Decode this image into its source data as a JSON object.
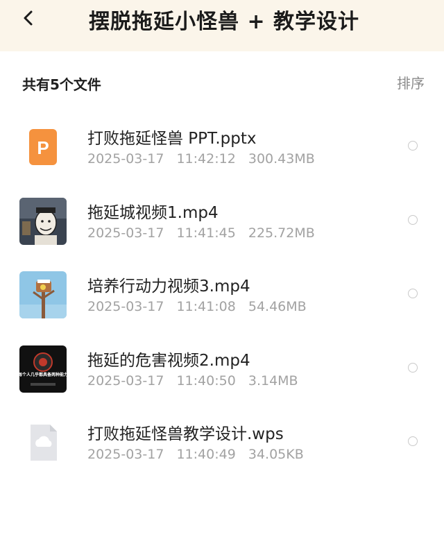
{
  "header": {
    "title": "摆脱拖延小怪兽 + 教学设计",
    "background": "#fbf5ea"
  },
  "toolbar": {
    "count_label": "共有5个文件",
    "sort_label": "排序"
  },
  "files": [
    {
      "name": "打败拖延怪兽 PPT.pptx",
      "date": "2025-03-17",
      "time": "11:42:12",
      "size": "300.43MB",
      "icon": "ppt-file-icon"
    },
    {
      "name": "拖延城视频1.mp4",
      "date": "2025-03-17",
      "time": "11:41:45",
      "size": "225.72MB",
      "icon": "video-thumbnail"
    },
    {
      "name": "培养行动力视频3.mp4",
      "date": "2025-03-17",
      "time": "11:41:08",
      "size": "54.46MB",
      "icon": "video-thumbnail"
    },
    {
      "name": "拖延的危害视频2.mp4",
      "date": "2025-03-17",
      "time": "11:40:50",
      "size": "3.14MB",
      "icon": "video-thumbnail"
    },
    {
      "name": "打败拖延怪兽教学设计.wps",
      "date": "2025-03-17",
      "time": "11:40:49",
      "size": "34.05KB",
      "icon": "cloud-file-icon"
    }
  ],
  "thumb_texts": {
    "video2_caption": "每个人几乎都具备两种能力"
  },
  "colors": {
    "ppt_orange": "#f5923e",
    "meta_gray": "#a2a2a2"
  }
}
